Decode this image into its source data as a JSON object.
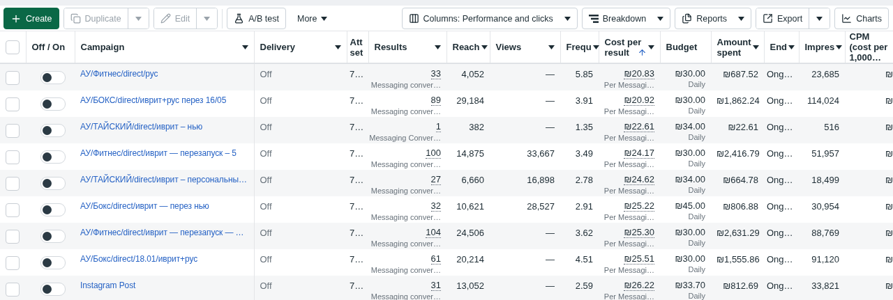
{
  "toolbar": {
    "left": [
      {
        "label": "Create",
        "kind": "primary",
        "disabled": false
      },
      {
        "label": "Duplicate",
        "kind": "split",
        "disabled": true
      },
      {
        "label": "Edit",
        "kind": "split",
        "disabled": true
      },
      {
        "label": "A/B test",
        "kind": "button",
        "disabled": false
      },
      {
        "label": "More",
        "kind": "menu",
        "disabled": false
      }
    ],
    "right": [
      {
        "label": "Columns: Performance and clicks",
        "kind": "dropdown",
        "disabled": false
      },
      {
        "label": "Breakdown",
        "kind": "dropdown",
        "disabled": false
      },
      {
        "label": "Reports",
        "kind": "dropdown",
        "disabled": false
      },
      {
        "label": "Export",
        "kind": "split",
        "disabled": false
      },
      {
        "label": "Charts",
        "kind": "button",
        "disabled": false
      }
    ]
  },
  "table": {
    "select_all": {
      "checked": false
    },
    "columns": [
      {
        "label": "Off / On",
        "caret": false,
        "sorted": false
      },
      {
        "label": "Campaign",
        "caret": true,
        "sorted": false
      },
      {
        "label": "Delivery",
        "caret": true,
        "sorted": false
      },
      {
        "label": "Att set",
        "caret": false,
        "sorted": false
      },
      {
        "label": "Results",
        "caret": true,
        "sorted": false
      },
      {
        "label": "Reach",
        "caret": true,
        "sorted": false
      },
      {
        "label": "Views",
        "caret": true,
        "sorted": false
      },
      {
        "label": "Frequ",
        "caret": true,
        "sorted": false
      },
      {
        "label": "Cost per result",
        "caret": true,
        "sorted": true
      },
      {
        "label": "Budget",
        "caret": false,
        "sorted": false
      },
      {
        "label": "Amount spent",
        "caret": true,
        "sorted": false
      },
      {
        "label": "End",
        "caret": true,
        "sorted": false
      },
      {
        "label": "Impres",
        "caret": true,
        "sorted": false
      },
      {
        "label": "CPM (cost per 1,000…",
        "caret": false,
        "sorted": false
      }
    ],
    "rows": [
      {
        "checked": false,
        "on": false,
        "campaign": "АУ/Фитнес/direct/рус",
        "delivery": "Off",
        "attribution": "7…",
        "results": "33",
        "result_type": "Messaging conver…",
        "reach": "4,052",
        "views": "—",
        "frequency": "5.85",
        "cost_per_result": "₪20.83",
        "cost_type": "Per Messagi…",
        "budget": "₪30.00",
        "budget_period": "Daily",
        "amount_spent": "₪687.52",
        "end": "Ong…",
        "impressions": "23,685",
        "cpm": "₪"
      },
      {
        "checked": false,
        "on": false,
        "campaign": "АУ/БОКС/direct/иврит+рус перез 16/05",
        "delivery": "Off",
        "attribution": "7…",
        "results": "89",
        "result_type": "Messaging conver…",
        "reach": "29,184",
        "views": "—",
        "frequency": "3.91",
        "cost_per_result": "₪20.92",
        "cost_type": "Per Messagi…",
        "budget": "₪30.00",
        "budget_period": "Daily",
        "amount_spent": "₪1,862.24",
        "end": "Ong…",
        "impressions": "114,024",
        "cpm": "₪"
      },
      {
        "checked": false,
        "on": false,
        "campaign": "АУ/ТАЙСКИЙ/direct/иврит – нью",
        "delivery": "Off",
        "attribution": "7…",
        "results": "1",
        "result_type": "Messaging Conver…",
        "reach": "382",
        "views": "—",
        "frequency": "1.35",
        "cost_per_result": "₪22.61",
        "cost_type": "Per Messagi…",
        "budget": "₪34.00",
        "budget_period": "Daily",
        "amount_spent": "₪22.61",
        "end": "Ong…",
        "impressions": "516",
        "cpm": "₪"
      },
      {
        "checked": false,
        "on": false,
        "campaign": "АУ/Фитнес/direct/иврит — перезапуск – 5",
        "delivery": "Off",
        "attribution": "7…",
        "results": "100",
        "result_type": "Messaging conver…",
        "reach": "14,875",
        "views": "33,667",
        "frequency": "3.49",
        "cost_per_result": "₪24.17",
        "cost_type": "Per Messagi…",
        "budget": "₪30.00",
        "budget_period": "Daily",
        "amount_spent": "₪2,416.79",
        "end": "Ong…",
        "impressions": "51,957",
        "cpm": "₪"
      },
      {
        "checked": false,
        "on": false,
        "campaign": "АУ/ТАЙСКИЙ/direct/иврит – персональны…",
        "delivery": "Off",
        "attribution": "7…",
        "results": "27",
        "result_type": "Messaging conver…",
        "reach": "6,660",
        "views": "16,898",
        "frequency": "2.78",
        "cost_per_result": "₪24.62",
        "cost_type": "Per Messagi…",
        "budget": "₪34.00",
        "budget_period": "Daily",
        "amount_spent": "₪664.78",
        "end": "Ong…",
        "impressions": "18,499",
        "cpm": "₪"
      },
      {
        "checked": false,
        "on": false,
        "campaign": "АУ/Бокс/direct/иврит — перез нью",
        "delivery": "Off",
        "attribution": "7…",
        "results": "32",
        "result_type": "Messaging conver…",
        "reach": "10,621",
        "views": "28,527",
        "frequency": "2.91",
        "cost_per_result": "₪25.22",
        "cost_type": "Per Messagi…",
        "budget": "₪45.00",
        "budget_period": "Daily",
        "amount_spent": "₪806.88",
        "end": "Ong…",
        "impressions": "30,954",
        "cpm": "₪"
      },
      {
        "checked": false,
        "on": false,
        "campaign": "АУ/Фитнес/direct/иврит — перезапуск — …",
        "delivery": "Off",
        "attribution": "7…",
        "results": "104",
        "result_type": "Messaging conver…",
        "reach": "24,506",
        "views": "—",
        "frequency": "3.62",
        "cost_per_result": "₪25.30",
        "cost_type": "Per Messagi…",
        "budget": "₪30.00",
        "budget_period": "Daily",
        "amount_spent": "₪2,631.29",
        "end": "Ong…",
        "impressions": "88,769",
        "cpm": "₪"
      },
      {
        "checked": false,
        "on": false,
        "campaign": "АУ/Бокс/direct/18.01/иврит+рус",
        "delivery": "Off",
        "attribution": "7…",
        "results": "61",
        "result_type": "Messaging conver…",
        "reach": "20,214",
        "views": "—",
        "frequency": "4.51",
        "cost_per_result": "₪25.51",
        "cost_type": "Per Messagi…",
        "budget": "₪30.00",
        "budget_period": "Daily",
        "amount_spent": "₪1,555.86",
        "end": "Ong…",
        "impressions": "91,120",
        "cpm": "₪"
      },
      {
        "checked": false,
        "on": false,
        "campaign": "Instagram Post",
        "delivery": "Off",
        "attribution": "7…",
        "results": "31",
        "result_type": "Messaging conver…",
        "reach": "13,052",
        "views": "—",
        "frequency": "2.59",
        "cost_per_result": "₪26.22",
        "cost_type": "Per Messagi…",
        "budget": "₪33.70",
        "budget_period": "Daily",
        "amount_spent": "₪812.69",
        "end": "Ong…",
        "impressions": "33,821",
        "cpm": "₪"
      }
    ]
  }
}
